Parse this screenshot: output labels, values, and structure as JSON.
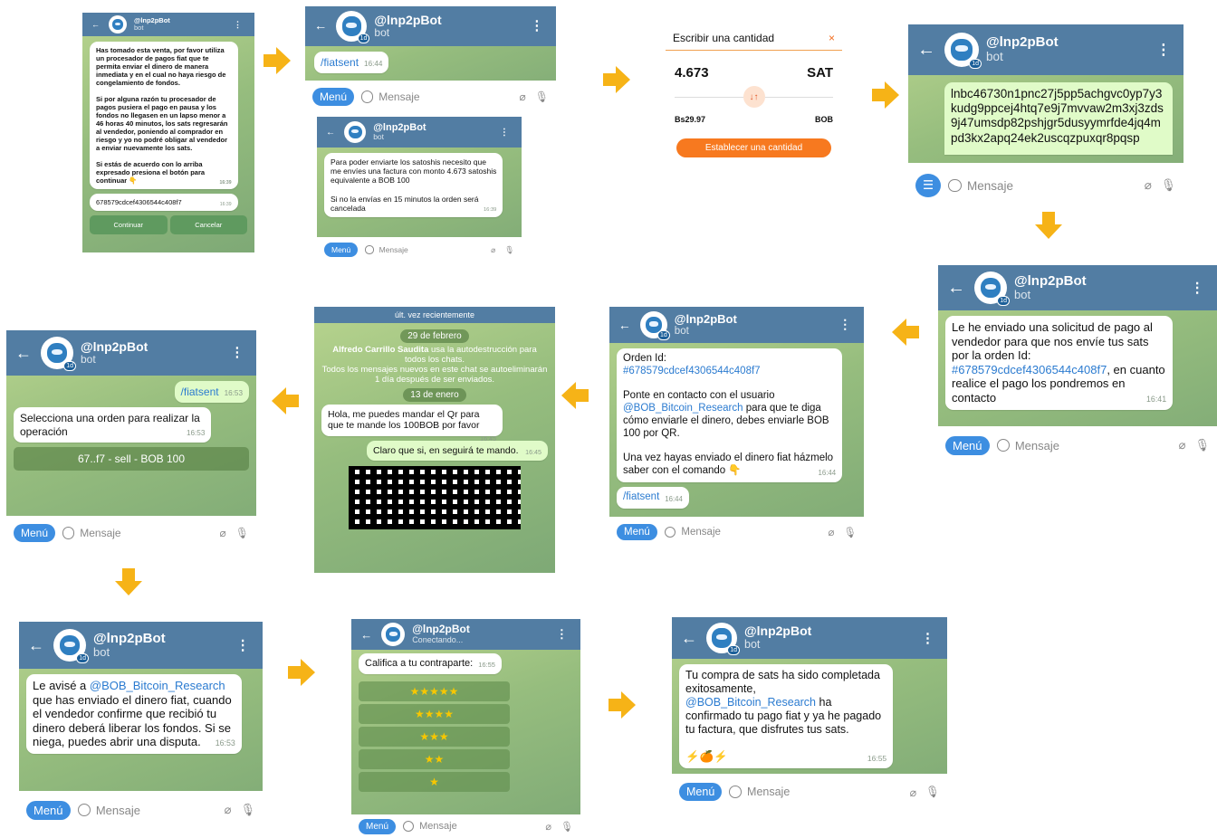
{
  "bot": {
    "name": "@lnp2pBot",
    "subtitle": "bot",
    "badge": "1d"
  },
  "input": {
    "menu": "Menú",
    "placeholder": "Mensaje"
  },
  "p1": {
    "text": "Has tomado esta venta, por favor utiliza un procesador de pagos fiat que te permita enviar el dinero de manera inmediata y en el cual no haya riesgo de congelamiento de fondos.\n\nSi por alguna razón tu procesador de pagos pusiera el pago en pausa y los fondos no llegasen en un lapso menor a 46 horas 40 minutos, los sats regresarán al vendedor, poniendo al comprador en riesgo y yo no podré obligar al vendedor a enviar nuevamente los sats.\n\nSi estás de acuerdo con lo arriba expresado presiona el botón para continuar 👇",
    "time": "16:39",
    "id": "678579cdcef4306544c408f7",
    "id_time": "16:39",
    "btn_continue": "Continuar",
    "btn_cancel": "Cancelar"
  },
  "p2": {
    "cmd": "/fiatsent",
    "time": "16:44"
  },
  "p3": {
    "text": "Para poder enviarte los satoshis necesito que me envíes una factura con monto 4.673 satoshis equivalente a BOB 100\n\nSi no la envías en 15 minutos la orden será cancelada",
    "time": "16:39"
  },
  "p4": {
    "title": "Escribir una cantidad",
    "close": "×",
    "amount": "4.673",
    "unit": "SAT",
    "fiat": "Bs29.97",
    "fiat_unit": "BOB",
    "button": "Establecer una cantidad",
    "swap": "↓↑"
  },
  "p5": {
    "invoice": "lnbc46730n1pnc27j5pp5achgvc0yp7y3kudg9ppcej4htq7e9j7mvvaw2m3xj3zds9j47umsdp82pshjgr5dusyymrfde4jq4mpd3kx2apq24ek2uscqzpuxqr8pqsp"
  },
  "p6": {
    "text_a": "Le he enviado una solicitud de pago al vendedor para que nos envíe tus sats por la orden Id: ",
    "order": "#678579cdcef4306544c408f7",
    "text_b": ", en cuanto realice el pago los pondremos en contacto",
    "time": "16:41"
  },
  "p7": {
    "title": "Orden Id:",
    "order": "#678579cdcef4306544c408f7",
    "text_a": "Ponte en contacto con el usuario ",
    "user": "@BOB_Bitcoin_Research",
    "text_b": " para que te diga cómo enviarle el dinero, debes enviarle BOB 100 por QR.",
    "text_c": "Una vez hayas enviado el dinero fiat házmelo saber con el comando 👇",
    "time": "16:44",
    "cmd": "/fiatsent",
    "cmd_time": "16:44"
  },
  "p8": {
    "status": "últ. vez recientemente",
    "date1": "29 de febrero",
    "sys_name": "Alfredo Carrillo Saudita",
    "sys1": " usa la autodestrucción para todos los chats.",
    "sys2": "Todos los mensajes nuevos en este chat se autoeliminarán 1 día después de ser enviados.",
    "date2": "13 de enero",
    "msg1": "Hola, me puedes mandar el Qr para que te mande los 100BOB por favor",
    "msg1_time": "16:45",
    "msg2": "Claro que si, en seguirá te mando.",
    "msg2_time": "16:45"
  },
  "p9": {
    "cmd": "/fiatsent",
    "cmd_time": "16:53",
    "text": "Selecciona una orden para realizar la operación",
    "time": "16:53",
    "btn": "67..f7 - sell - BOB 100"
  },
  "p10": {
    "text_a": "Le avisé a ",
    "user": "@BOB_Bitcoin_Research",
    "text_b": " que has enviado el dinero fiat, cuando el vendedor confirme que recibió tu dinero deberá liberar los fondos. Si se niega, puedes abrir una disputa.",
    "time": "16:53"
  },
  "p11": {
    "subtitle": "Conectando...",
    "text": "Califica a tu contraparte:",
    "time": "16:55",
    "stars": [
      "★★★★★",
      "★★★★",
      "★★★",
      "★★",
      "★"
    ]
  },
  "p12": {
    "text_a": "Tu compra de sats ha sido completada exitosamente, ",
    "user": "@BOB_Bitcoin_Research",
    "text_b": " ha confirmado tu pago fiat y ya he pagado tu factura, que disfrutes tus sats.",
    "emoji": "⚡🍊⚡",
    "time": "16:55"
  },
  "colors": {
    "header": "#527da3",
    "arrow": "#f6b317",
    "menu": "#3d8ee1"
  }
}
